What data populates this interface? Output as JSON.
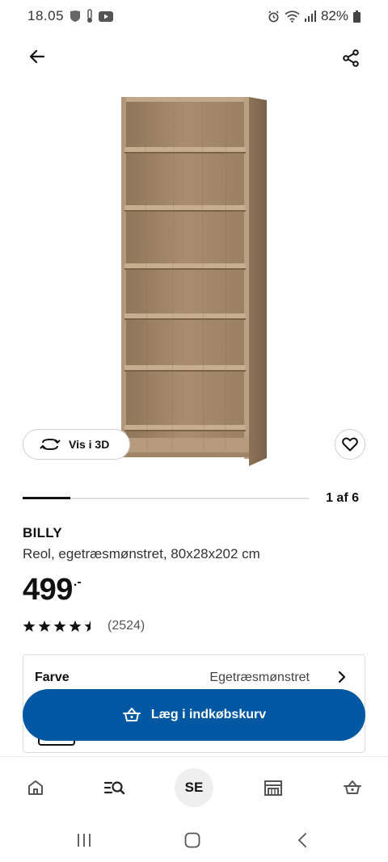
{
  "status_bar": {
    "time": "18.05",
    "battery": "82%",
    "left_icons": [
      "nfl-icon",
      "thermometer-icon",
      "youtube-icon"
    ],
    "right_icons": [
      "alarm-icon",
      "wifi-icon",
      "signal-icon",
      "battery-icon"
    ]
  },
  "top_bar": {
    "back_icon": "arrow-left-icon",
    "share_icon": "share-icon"
  },
  "gallery": {
    "view_3d_label": "Vis i 3D",
    "counter": "1 af 6",
    "progress": 0.1667
  },
  "product": {
    "name": "BILLY",
    "description": "Reol, egetræsmønstret, 80x28x202 cm",
    "price": "499",
    "price_suffix": ".-",
    "rating": 4.5,
    "rating_max": 5,
    "review_count": "(2524)"
  },
  "color_option": {
    "label": "Farve",
    "value": "Egetræsmønstret"
  },
  "cart": {
    "label": "Læg i indkøbskurv"
  },
  "bottom_nav": {
    "items": [
      {
        "icon": "home-icon"
      },
      {
        "icon": "search-list-icon"
      },
      {
        "label": "SE"
      },
      {
        "icon": "store-icon"
      },
      {
        "icon": "basket-icon"
      }
    ]
  },
  "colors": {
    "accent": "#0058a3",
    "wood": "#a58a6c"
  }
}
